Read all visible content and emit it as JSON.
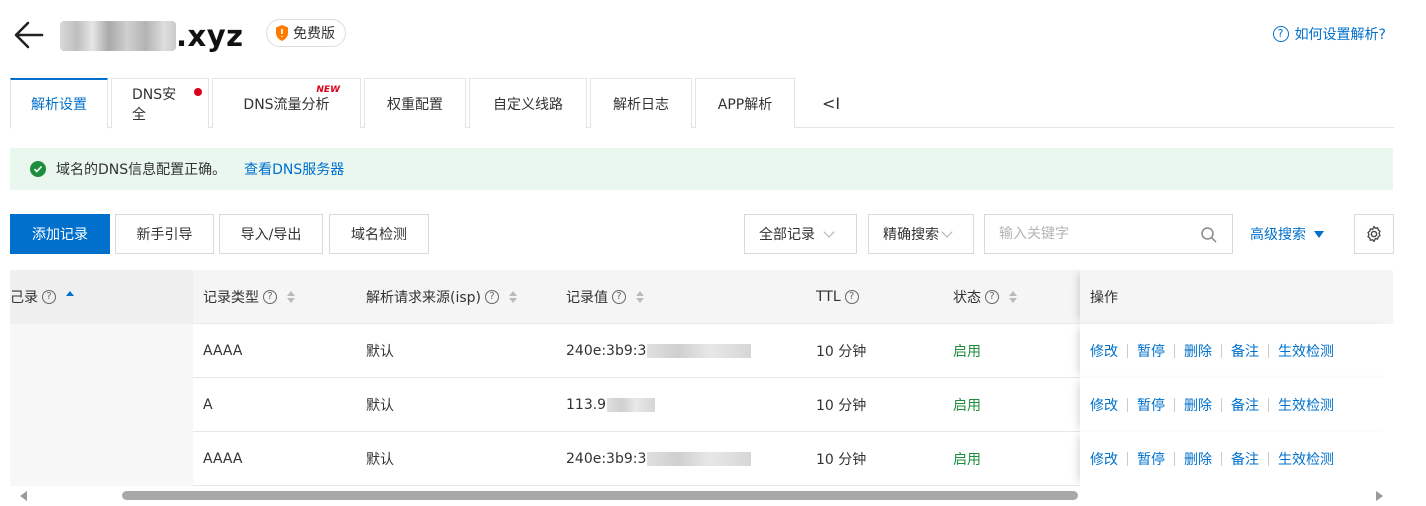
{
  "header": {
    "domain_suffix": ".xyz",
    "edition": "免费版",
    "help_link": "如何设置解析?"
  },
  "tabs": [
    {
      "label": "解析设置",
      "active": true
    },
    {
      "label": "DNS安全",
      "dot": true
    },
    {
      "label": "DNS流量分析",
      "badge": "NEW"
    },
    {
      "label": "权重配置"
    },
    {
      "label": "自定义线路"
    },
    {
      "label": "解析日志"
    },
    {
      "label": "APP解析"
    }
  ],
  "tab_collapse": "<I",
  "alert": {
    "text": "域名的DNS信息配置正确。",
    "link": "查看DNS服务器"
  },
  "toolbar": {
    "add": "添加记录",
    "guide": "新手引导",
    "import_export": "导入/导出",
    "check": "域名检测",
    "filter": "全部记录",
    "search_mode": "精确搜索",
    "search_placeholder": "输入关键字",
    "advanced": "高级搜索"
  },
  "table": {
    "headers": {
      "host": "己录",
      "type": "记录类型",
      "source": "解析请求来源(isp)",
      "value": "记录值",
      "ttl": "TTL",
      "status": "状态",
      "actions": "操作"
    },
    "rows": [
      {
        "type": "AAAA",
        "source": "默认",
        "value": "240e:3b9:3",
        "ttl": "10 分钟",
        "status": "启用"
      },
      {
        "type": "A",
        "source": "默认",
        "value": "113.9",
        "ttl": "10 分钟",
        "status": "启用"
      },
      {
        "type": "AAAA",
        "source": "默认",
        "value": "240e:3b9:3",
        "ttl": "10 分钟",
        "status": "启用"
      }
    ],
    "actions": {
      "edit": "修改",
      "pause": "暂停",
      "delete": "删除",
      "remark": "备注",
      "verify": "生效检测"
    }
  },
  "colors": {
    "accent": "#0070cc",
    "success": "#1e8e3e",
    "alert_bg": "#e9f7ef",
    "badge_red": "#d9001b"
  }
}
